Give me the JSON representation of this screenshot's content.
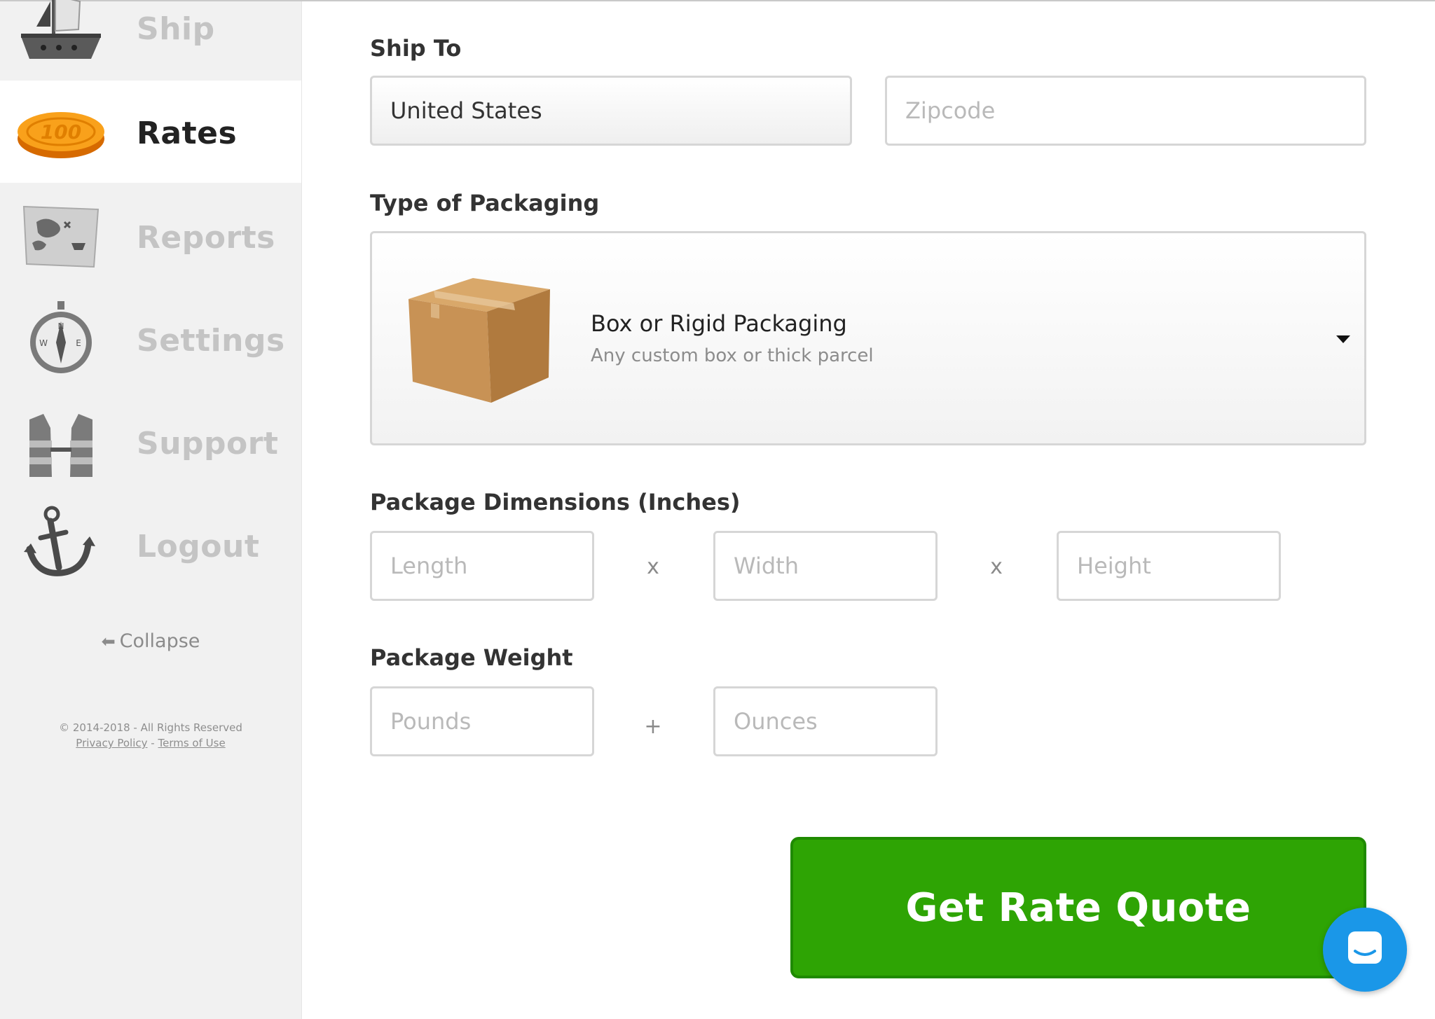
{
  "sidebar": {
    "items": [
      {
        "label": "Ship",
        "icon": "pirate-ship-icon",
        "active": false
      },
      {
        "label": "Rates",
        "icon": "gold-coin-icon",
        "active": true
      },
      {
        "label": "Reports",
        "icon": "treasure-map-icon",
        "active": false
      },
      {
        "label": "Settings",
        "icon": "compass-icon",
        "active": false
      },
      {
        "label": "Support",
        "icon": "life-vest-icon",
        "active": false
      },
      {
        "label": "Logout",
        "icon": "anchor-icon",
        "active": false
      }
    ],
    "collapse_label": "Collapse",
    "copyright": "© 2014-2018 - All Rights Reserved",
    "privacy_label": "Privacy Policy",
    "legal_separator": " - ",
    "terms_label": "Terms of Use"
  },
  "form": {
    "ship_to_label": "Ship To",
    "country_value": "United States",
    "zipcode_placeholder": "Zipcode",
    "packaging_label": "Type of Packaging",
    "packaging_title": "Box or Rigid Packaging",
    "packaging_subtitle": "Any custom box or thick parcel",
    "dimensions_label": "Package Dimensions (Inches)",
    "length_placeholder": "Length",
    "width_placeholder": "Width",
    "height_placeholder": "Height",
    "dim_separator": "x",
    "weight_label": "Package Weight",
    "pounds_placeholder": "Pounds",
    "ounces_placeholder": "Ounces",
    "weight_separator": "+",
    "submit_label": "Get Rate Quote"
  },
  "colors": {
    "accent_green": "#2ea404",
    "chat_blue": "#1a97e8"
  }
}
